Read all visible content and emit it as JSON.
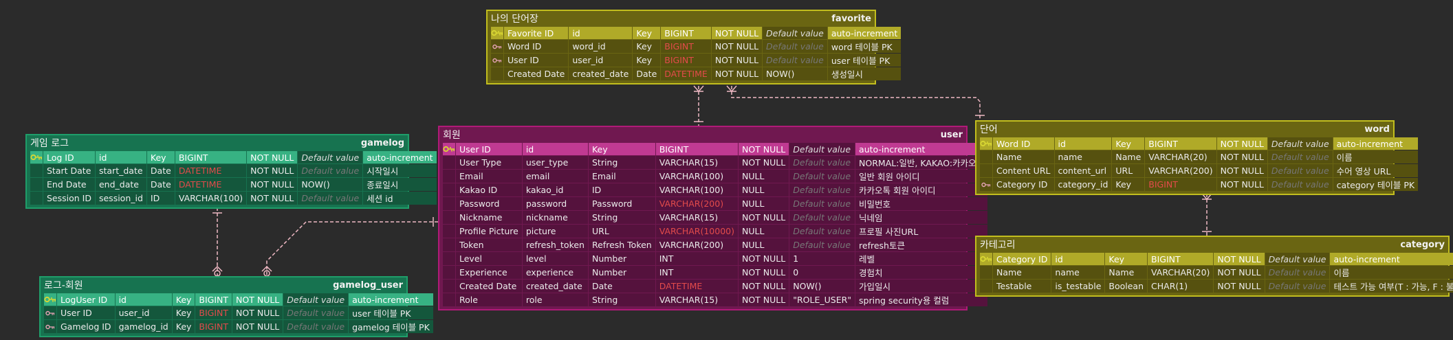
{
  "entities": {
    "favorite": {
      "title": "나의 단어장",
      "name": "favorite",
      "rows": [
        {
          "key": "pk",
          "c": [
            "Favorite ID",
            "id",
            "Key",
            "BIGINT",
            "NOT NULL",
            "Default value",
            "auto-increment"
          ]
        },
        {
          "key": "fk",
          "c": [
            "Word ID",
            "word_id",
            "Key",
            "BIGINT",
            "NOT NULL",
            "Default value",
            "word 테이블 PK"
          ]
        },
        {
          "key": "fk",
          "c": [
            "User ID",
            "user_id",
            "Key",
            "BIGINT",
            "NOT NULL",
            "Default value",
            "user 테이블 PK"
          ]
        },
        {
          "key": "",
          "c": [
            "Created Date",
            "created_date",
            "Date",
            "DATETIME",
            "NOT NULL",
            "NOW()",
            "생성일시"
          ]
        }
      ]
    },
    "gamelog": {
      "title": "게임 로그",
      "name": "gamelog",
      "rows": [
        {
          "key": "pk",
          "c": [
            "Log ID",
            "id",
            "Key",
            "BIGINT",
            "NOT NULL",
            "Default value",
            "auto-increment"
          ]
        },
        {
          "key": "",
          "c": [
            "Start Date",
            "start_date",
            "Date",
            "DATETIME",
            "NOT NULL",
            "Default value",
            "시작일시"
          ]
        },
        {
          "key": "",
          "c": [
            "End Date",
            "end_date",
            "Date",
            "DATETIME",
            "NOT NULL",
            "NOW()",
            "종료일시"
          ]
        },
        {
          "key": "",
          "c": [
            "Session ID",
            "session_id",
            "ID",
            "VARCHAR(100)",
            "NOT NULL",
            "Default value",
            "세션 id"
          ]
        }
      ]
    },
    "user": {
      "title": "회원",
      "name": "user",
      "rows": [
        {
          "key": "pk",
          "c": [
            "User ID",
            "id",
            "Key",
            "BIGINT",
            "NOT NULL",
            "Default value",
            "auto-increment"
          ]
        },
        {
          "key": "",
          "c": [
            "User Type",
            "user_type",
            "String",
            "VARCHAR(15)",
            "NOT NULL",
            "Default value",
            "NORMAL:일반, KAKAO:카카오톡"
          ]
        },
        {
          "key": "",
          "c": [
            "Email",
            "email",
            "Email",
            "VARCHAR(100)",
            "NULL",
            "Default value",
            "일반 회원 아이디"
          ]
        },
        {
          "key": "",
          "c": [
            "Kakao ID",
            "kakao_id",
            "ID",
            "VARCHAR(100)",
            "NULL",
            "Default value",
            "카카오톡 회원 아이디"
          ]
        },
        {
          "key": "",
          "c": [
            "Password",
            "password",
            "Password",
            "VARCHAR(200)",
            "NULL",
            "Default value",
            "비밀번호"
          ]
        },
        {
          "key": "",
          "c": [
            "Nickname",
            "nickname",
            "String",
            "VARCHAR(15)",
            "NOT NULL",
            "Default value",
            "닉네임"
          ]
        },
        {
          "key": "",
          "c": [
            "Profile Picture",
            "picture",
            "URL",
            "VARCHAR(10000)",
            "NULL",
            "Default value",
            "프로필 사진URL"
          ]
        },
        {
          "key": "",
          "c": [
            "Token",
            "refresh_token",
            "Refresh Token",
            "VARCHAR(200)",
            "NULL",
            "Default value",
            "refresh토큰"
          ]
        },
        {
          "key": "",
          "c": [
            "Level",
            "level",
            "Number",
            "INT",
            "NOT NULL",
            "1",
            "레벨"
          ]
        },
        {
          "key": "",
          "c": [
            "Experience",
            "experience",
            "Number",
            "INT",
            "NOT NULL",
            "0",
            "경험치"
          ]
        },
        {
          "key": "",
          "c": [
            "Created Date",
            "created_date",
            "Date",
            "DATETIME",
            "NOT NULL",
            "NOW()",
            "가입일시"
          ]
        },
        {
          "key": "",
          "c": [
            "Role",
            "role",
            "String",
            "VARCHAR(15)",
            "NOT NULL",
            "\"ROLE_USER\"",
            "spring security용 컬럼"
          ]
        }
      ]
    },
    "word": {
      "title": "단어",
      "name": "word",
      "rows": [
        {
          "key": "pk",
          "c": [
            "Word ID",
            "id",
            "Key",
            "BIGINT",
            "NOT NULL",
            "Default value",
            "auto-increment"
          ]
        },
        {
          "key": "",
          "c": [
            "Name",
            "name",
            "Name",
            "VARCHAR(20)",
            "NOT NULL",
            "Default value",
            "이름"
          ]
        },
        {
          "key": "",
          "c": [
            "Content URL",
            "content_url",
            "URL",
            "VARCHAR(200)",
            "NOT NULL",
            "Default value",
            "수어 영상 URL"
          ]
        },
        {
          "key": "fk",
          "c": [
            "Category ID",
            "category_id",
            "Key",
            "BIGINT",
            "NOT NULL",
            "Default value",
            "category 테이블 PK"
          ]
        }
      ]
    },
    "category": {
      "title": "카테고리",
      "name": "category",
      "rows": [
        {
          "key": "pk",
          "c": [
            "Category ID",
            "id",
            "Key",
            "BIGINT",
            "NOT NULL",
            "Default value",
            "auto-increment"
          ]
        },
        {
          "key": "",
          "c": [
            "Name",
            "name",
            "Name",
            "VARCHAR(20)",
            "NOT NULL",
            "Default value",
            "이름"
          ]
        },
        {
          "key": "",
          "c": [
            "Testable",
            "is_testable",
            "Boolean",
            "CHAR(1)",
            "NOT NULL",
            "Default value",
            "테스트 가능 여부(T : 가능, F : 불가능)"
          ]
        }
      ]
    },
    "gamelog_user": {
      "title": "로그-회원",
      "name": "gamelog_user",
      "rows": [
        {
          "key": "pk",
          "c": [
            "LogUser ID",
            "id",
            "Key",
            "BIGINT",
            "NOT NULL",
            "Default value",
            "auto-increment"
          ]
        },
        {
          "key": "fk",
          "c": [
            "User ID",
            "user_id",
            "Key",
            "BIGINT",
            "NOT NULL",
            "Default value",
            "user 테이블 PK"
          ]
        },
        {
          "key": "fk",
          "c": [
            "Gamelog ID",
            "gamelog_id",
            "Key",
            "BIGINT",
            "NOT NULL",
            "Default value",
            "gamelog 테이블 PK"
          ]
        }
      ]
    }
  },
  "colors": {
    "green_border": "#1f9e6a",
    "olive_border": "#c2be1e",
    "magenta_border": "#b01a78",
    "type_text": "#e34b4b",
    "key_icon": "#d9d733",
    "fk_icon": "#e6a3b5",
    "connector": "#f0b9c4",
    "background": "#2b2b2b"
  }
}
